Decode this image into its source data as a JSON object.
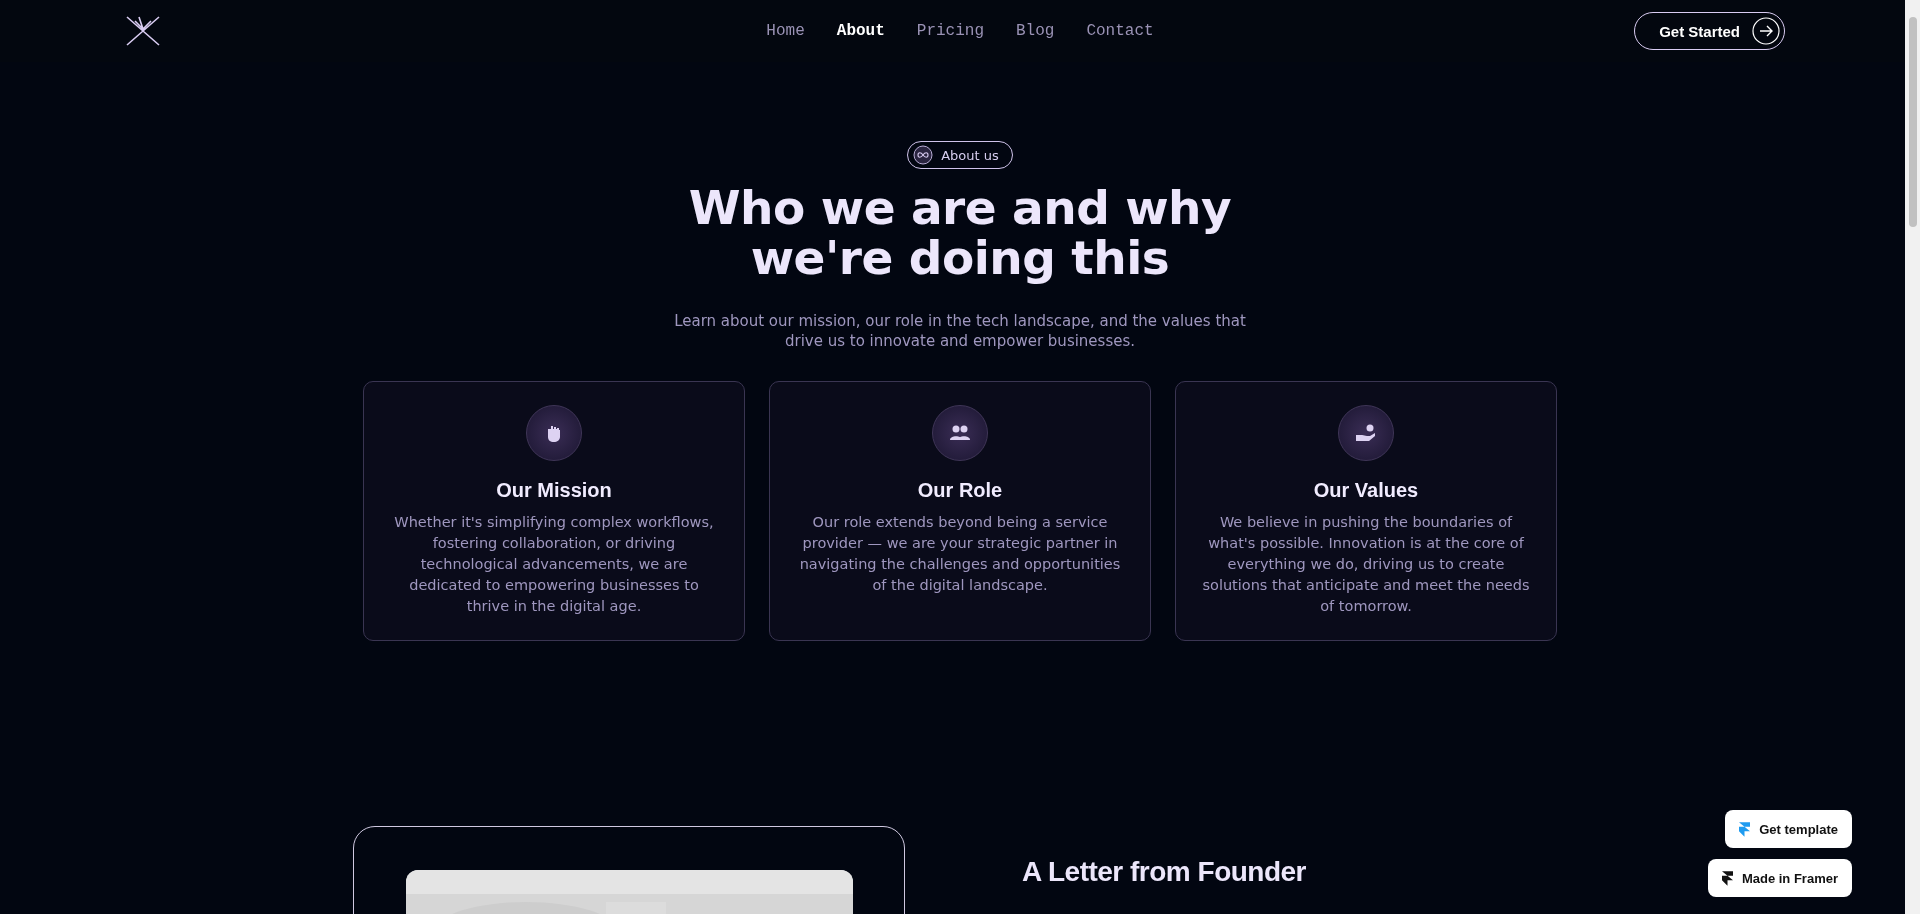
{
  "nav": {
    "links": [
      {
        "label": "Home",
        "selected": false
      },
      {
        "label": "About",
        "selected": true
      },
      {
        "label": "Pricing",
        "selected": false
      },
      {
        "label": "Blog",
        "selected": false
      },
      {
        "label": "Contact",
        "selected": false
      }
    ],
    "cta": "Get Started"
  },
  "hero": {
    "badge": "About us",
    "title_lines": [
      "Who we are and why",
      "we're doing this"
    ],
    "subtitle": "Learn about our mission, our role in the tech landscape, and the values that drive us to innovate and empower businesses."
  },
  "cards": [
    {
      "kind": "fist",
      "title": "Our Mission",
      "text": "Whether it's simplifying complex workflows, fostering collaboration, or driving technological advancements, we are dedicated to empowering businesses to thrive in the digital age."
    },
    {
      "kind": "people",
      "title": "Our Role",
      "text": "Our role extends beyond being a service provider — we are your strategic partner in navigating the challenges and opportunities of the digital landscape."
    },
    {
      "kind": "hand",
      "title": "Our Values",
      "text": "We believe in pushing the boundaries of what's possible. Innovation is at the core of everything we do, driving us to create solutions that anticipate and meet the needs of tomorrow."
    }
  ],
  "founder": {
    "title": "A Letter from Founder"
  },
  "floating_buttons": [
    "Get template",
    "Made in Framer"
  ]
}
